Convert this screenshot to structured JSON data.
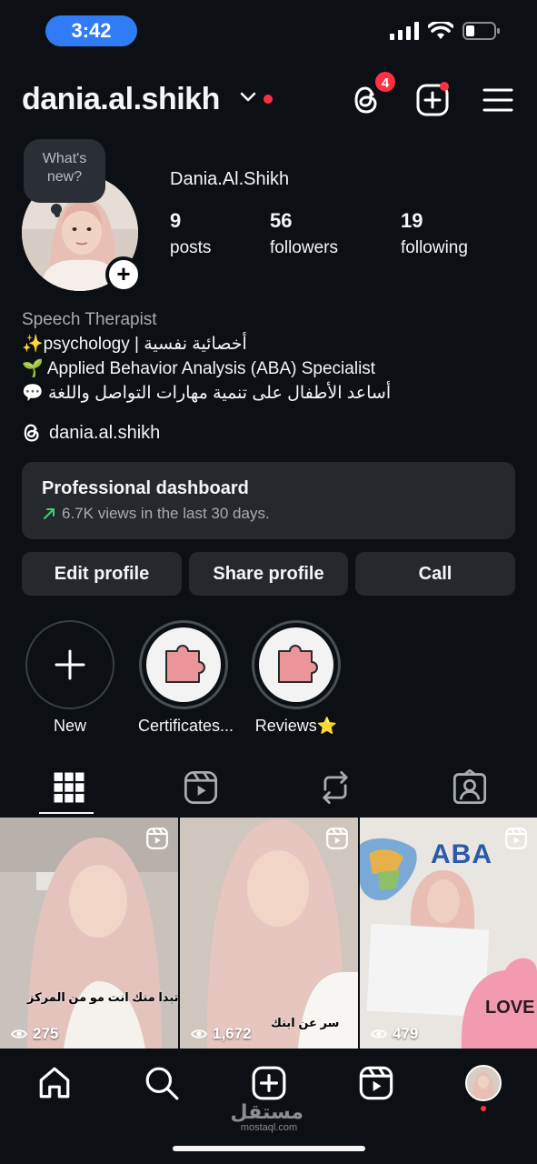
{
  "status_bar": {
    "time": "3:42"
  },
  "header": {
    "username": "dania.al.shikh",
    "threads_badge": "4",
    "icons": [
      "chevron-down-icon",
      "threads-icon",
      "new-post-icon",
      "menu-icon"
    ]
  },
  "profile": {
    "note_placeholder": "What's new?",
    "display_name": "Dania.Al.Shikh",
    "stats": [
      {
        "value": "9",
        "label": "posts"
      },
      {
        "value": "56",
        "label": "followers"
      },
      {
        "value": "19",
        "label": "following"
      }
    ],
    "bio": {
      "category": "Speech Therapist",
      "line1": "✨psychology | أخصائية نفسية",
      "line2": "🌱 Applied Behavior Analysis (ABA) Specialist",
      "line3": "💬 أساعد الأطفال على تنمية مهارات التواصل واللغة"
    },
    "threads_handle": "dania.al.shikh"
  },
  "dashboard": {
    "title": "Professional dashboard",
    "subtitle": "6.7K views in the last 30 days."
  },
  "buttons": {
    "edit": "Edit profile",
    "share": "Share profile",
    "call": "Call"
  },
  "highlights": [
    {
      "label": "New"
    },
    {
      "label": "Certificates..."
    },
    {
      "label": "Reviews⭐"
    }
  ],
  "tabs": [
    "grid-icon",
    "reels-icon",
    "reposts-icon",
    "tagged-icon"
  ],
  "posts": [
    {
      "views": "275",
      "caption": "تبدا منك انت مو من المركز"
    },
    {
      "views": "1,672",
      "caption": "سر عن ابنك"
    },
    {
      "views": "479",
      "sign_text": "ABA",
      "heart_text": "LOVE"
    }
  ],
  "watermark": {
    "arabic": "مستقل",
    "latin": "mostaql.com"
  },
  "colors": {
    "background": "#0c1014",
    "card": "#25292e",
    "accent_blue": "#2f7cf6",
    "notification_red": "#ff3040",
    "trend_green": "#3bd16f"
  }
}
